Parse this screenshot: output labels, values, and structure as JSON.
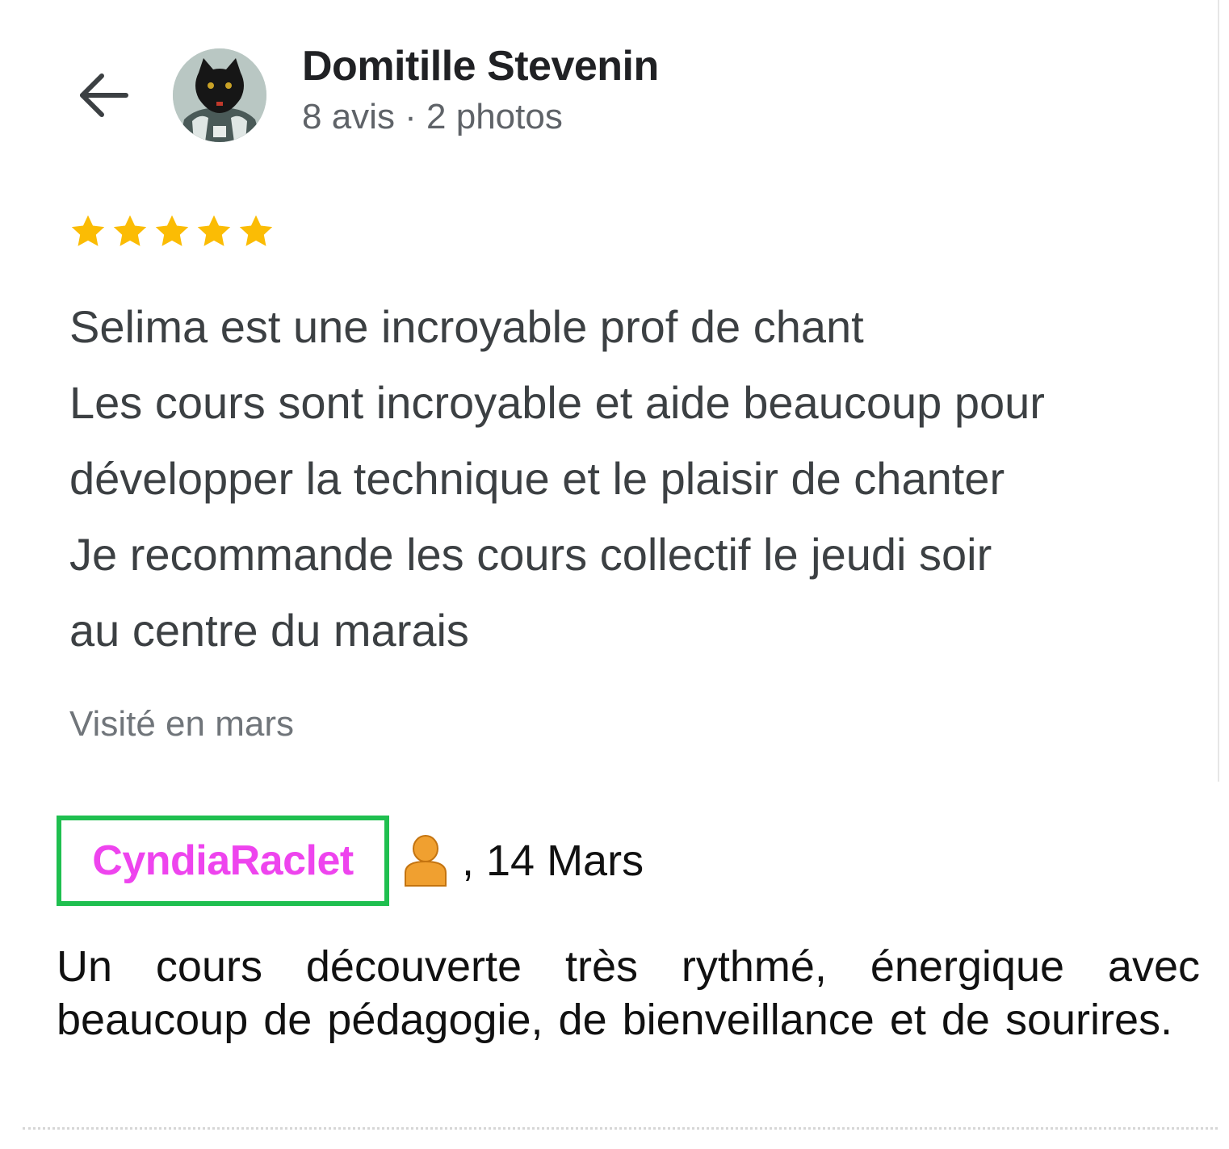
{
  "review1": {
    "author": {
      "name": "Domitille Stevenin",
      "meta": "8 avis · 2 photos"
    },
    "rating": 5,
    "rating_max": 5,
    "text_lines": [
      "Selima est une incroyable prof de chant",
      "Les cours sont incroyable et aide beaucoup pour",
      "développer la technique et le plaisir de chanter",
      "Je recommande les cours collectif le jeudi soir",
      "au centre du marais"
    ],
    "visit": "Visité en mars"
  },
  "review2": {
    "username": "CyndiaRaclet",
    "date": ", 14 Mars",
    "text": "Un cours découverte très rythmé, énergique avec beaucoup de pédagogie, de bienveillance et de sourires."
  },
  "colors": {
    "star": "#fbbc04",
    "username": "#ee44ee",
    "username_border": "#1fbf4f",
    "user_icon": "#f0a030"
  },
  "icons": {
    "back": "arrow-left-icon",
    "star": "star-icon",
    "user": "user-icon"
  }
}
